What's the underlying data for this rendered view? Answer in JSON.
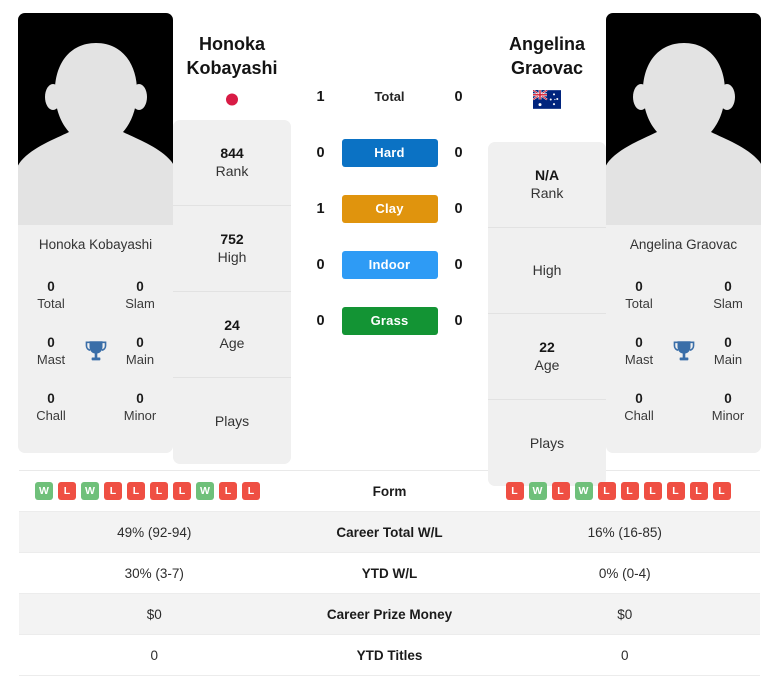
{
  "players": {
    "left": {
      "name_line1": "Honoka",
      "name_line2": "Kobayashi",
      "full_name": "Honoka Kobayashi",
      "flag": "japan-flag",
      "rank": "844",
      "rank_label": "Rank",
      "high": "752",
      "high_label": "High",
      "age": "24",
      "age_label": "Age",
      "plays": "",
      "plays_label": "Plays",
      "titles": {
        "total": "0",
        "total_label": "Total",
        "slam": "0",
        "slam_label": "Slam",
        "mast": "0",
        "mast_label": "Mast",
        "main": "0",
        "main_label": "Main",
        "chall": "0",
        "chall_label": "Chall",
        "minor": "0",
        "minor_label": "Minor"
      },
      "form": [
        "W",
        "L",
        "W",
        "L",
        "L",
        "L",
        "L",
        "W",
        "L",
        "L"
      ]
    },
    "right": {
      "name_line1": "Angelina",
      "name_line2": "Graovac",
      "full_name": "Angelina Graovac",
      "flag": "australia-flag",
      "rank": "N/A",
      "rank_label": "Rank",
      "high": "",
      "high_label": "High",
      "age": "22",
      "age_label": "Age",
      "plays": "",
      "plays_label": "Plays",
      "titles": {
        "total": "0",
        "total_label": "Total",
        "slam": "0",
        "slam_label": "Slam",
        "mast": "0",
        "mast_label": "Mast",
        "main": "0",
        "main_label": "Main",
        "chall": "0",
        "chall_label": "Chall",
        "minor": "0",
        "minor_label": "Minor"
      },
      "form": [
        "L",
        "W",
        "L",
        "W",
        "L",
        "L",
        "L",
        "L",
        "L",
        "L"
      ]
    }
  },
  "head_to_head": [
    {
      "label": "Total",
      "left": "1",
      "right": "0",
      "style": "plain",
      "color": ""
    },
    {
      "label": "Hard",
      "left": "0",
      "right": "0",
      "style": "badge",
      "color": "#0b72c4"
    },
    {
      "label": "Clay",
      "left": "1",
      "right": "0",
      "style": "badge",
      "color": "#e0940d"
    },
    {
      "label": "Indoor",
      "left": "0",
      "right": "0",
      "style": "badge",
      "color": "#2e9bf5"
    },
    {
      "label": "Grass",
      "left": "0",
      "right": "0",
      "style": "badge",
      "color": "#139434"
    }
  ],
  "stats_table": [
    {
      "label": "Form",
      "left": "",
      "right": "",
      "type": "form"
    },
    {
      "label": "Career Total W/L",
      "left": "49% (92-94)",
      "right": "16% (16-85)",
      "type": "text"
    },
    {
      "label": "YTD W/L",
      "left": "30% (3-7)",
      "right": "0% (0-4)",
      "type": "text"
    },
    {
      "label": "Career Prize Money",
      "left": "$0",
      "right": "$0",
      "type": "text"
    },
    {
      "label": "YTD Titles",
      "left": "0",
      "right": "0",
      "type": "text"
    }
  ],
  "colors": {
    "hard": "#0b72c4",
    "clay": "#e0940d",
    "indoor": "#2e9bf5",
    "grass": "#139434",
    "win": "#6fc07a",
    "loss": "#ef4f43",
    "trophy": "#3a6ea8"
  }
}
